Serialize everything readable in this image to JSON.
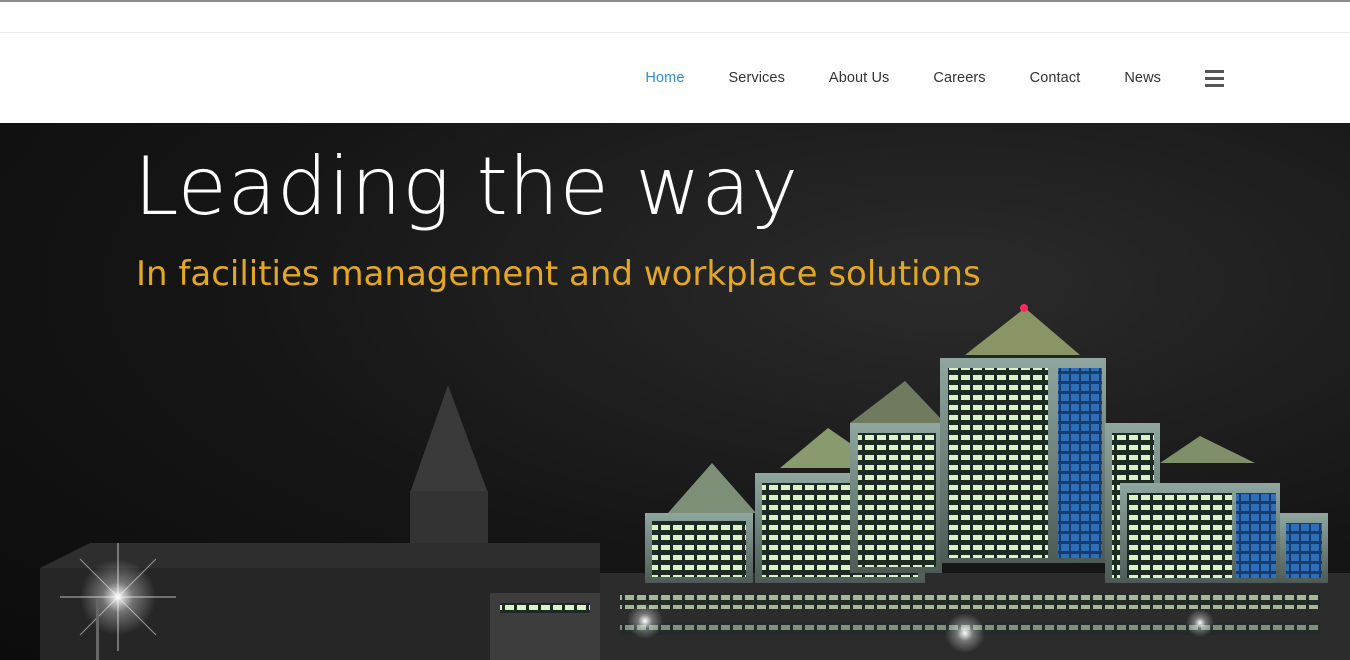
{
  "nav": {
    "items": [
      {
        "label": "Home",
        "active": true
      },
      {
        "label": "Services",
        "active": false
      },
      {
        "label": "About Us",
        "active": false
      },
      {
        "label": "Careers",
        "active": false
      },
      {
        "label": "Contact",
        "active": false
      },
      {
        "label": "News",
        "active": false
      }
    ],
    "menu_icon": "hamburger-icon",
    "active_color": "#2f8fd6"
  },
  "hero": {
    "headline": "Leading the way",
    "subheadline": "In facilities management and workplace solutions",
    "subheadline_color": "#e3a721",
    "image": "night-city-skyline"
  }
}
